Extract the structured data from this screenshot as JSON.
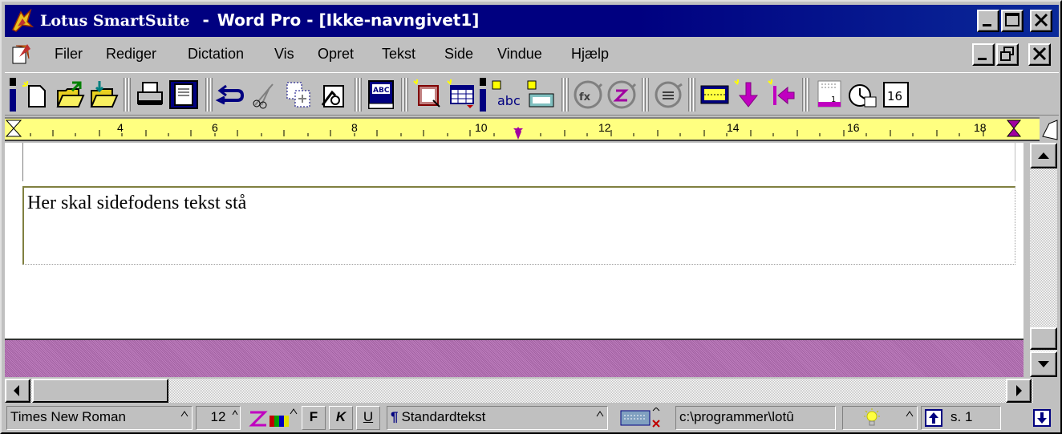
{
  "titlebar": {
    "suite": "Lotus SmartSuite",
    "separator": "-",
    "app_title": "Word Pro - [Ikke-navngivet1]"
  },
  "menu": {
    "items": [
      "Filer",
      "Rediger",
      "Dictation",
      "Vis",
      "Opret",
      "Tekst",
      "Side",
      "Vindue",
      "Hjælp"
    ]
  },
  "ruler": {
    "numbers": [
      "4",
      "6",
      "8",
      "10",
      "12",
      "14",
      "16",
      "18"
    ]
  },
  "document": {
    "footer_text": "Her skal sidefodens tekst stå"
  },
  "statusbar": {
    "font_name": "Times New Roman",
    "font_size": "12",
    "bold_label": "F",
    "italic_label": "K",
    "underline_label": "U",
    "paragraph_style": "Standardtekst",
    "path": "c:\\programmer\\lotû",
    "page": "s. 1"
  },
  "toolbar": {
    "spell_label": "ABC",
    "abc_label": "abc",
    "date_label": "16"
  },
  "colors": {
    "title_bg": "#000080",
    "ruler_bg": "#ffff80",
    "page_gap": "#b070b0"
  }
}
